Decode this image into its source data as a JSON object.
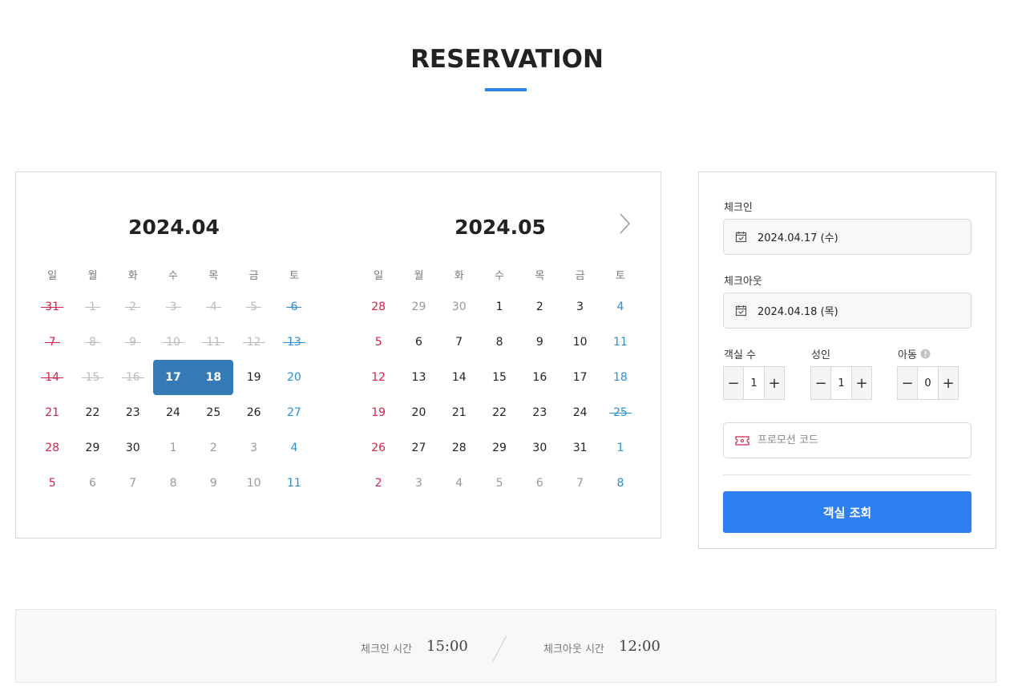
{
  "page": {
    "title": "RESERVATION"
  },
  "calendar": {
    "weekdays": [
      "일",
      "월",
      "화",
      "수",
      "목",
      "금",
      "토"
    ],
    "months": [
      {
        "title": "2024.04",
        "weeks": [
          [
            {
              "d": "31",
              "s": "dis"
            },
            {
              "d": "1",
              "s": "dis"
            },
            {
              "d": "2",
              "s": "dis"
            },
            {
              "d": "3",
              "s": "dis"
            },
            {
              "d": "4",
              "s": "dis"
            },
            {
              "d": "5",
              "s": "dis"
            },
            {
              "d": "6",
              "s": "dis"
            }
          ],
          [
            {
              "d": "7",
              "s": "dis"
            },
            {
              "d": "8",
              "s": "dis"
            },
            {
              "d": "9",
              "s": "dis"
            },
            {
              "d": "10",
              "s": "dis"
            },
            {
              "d": "11",
              "s": "dis"
            },
            {
              "d": "12",
              "s": "dis"
            },
            {
              "d": "13",
              "s": "dis"
            }
          ],
          [
            {
              "d": "14",
              "s": "dis"
            },
            {
              "d": "15",
              "s": "dis"
            },
            {
              "d": "16",
              "s": "dis"
            },
            {
              "d": "17",
              "s": "sel-start"
            },
            {
              "d": "18",
              "s": "sel-end"
            },
            {
              "d": "19",
              "s": ""
            },
            {
              "d": "20",
              "s": ""
            }
          ],
          [
            {
              "d": "21",
              "s": ""
            },
            {
              "d": "22",
              "s": ""
            },
            {
              "d": "23",
              "s": ""
            },
            {
              "d": "24",
              "s": ""
            },
            {
              "d": "25",
              "s": ""
            },
            {
              "d": "26",
              "s": ""
            },
            {
              "d": "27",
              "s": ""
            }
          ],
          [
            {
              "d": "28",
              "s": ""
            },
            {
              "d": "29",
              "s": ""
            },
            {
              "d": "30",
              "s": ""
            },
            {
              "d": "1",
              "s": "other"
            },
            {
              "d": "2",
              "s": "other"
            },
            {
              "d": "3",
              "s": "other"
            },
            {
              "d": "4",
              "s": "other"
            }
          ],
          [
            {
              "d": "5",
              "s": "other"
            },
            {
              "d": "6",
              "s": "other"
            },
            {
              "d": "7",
              "s": "other"
            },
            {
              "d": "8",
              "s": "other"
            },
            {
              "d": "9",
              "s": "other"
            },
            {
              "d": "10",
              "s": "other"
            },
            {
              "d": "11",
              "s": "other"
            }
          ]
        ]
      },
      {
        "title": "2024.05",
        "weeks": [
          [
            {
              "d": "28",
              "s": "other"
            },
            {
              "d": "29",
              "s": "other"
            },
            {
              "d": "30",
              "s": "other"
            },
            {
              "d": "1",
              "s": ""
            },
            {
              "d": "2",
              "s": ""
            },
            {
              "d": "3",
              "s": ""
            },
            {
              "d": "4",
              "s": ""
            }
          ],
          [
            {
              "d": "5",
              "s": ""
            },
            {
              "d": "6",
              "s": ""
            },
            {
              "d": "7",
              "s": ""
            },
            {
              "d": "8",
              "s": ""
            },
            {
              "d": "9",
              "s": ""
            },
            {
              "d": "10",
              "s": ""
            },
            {
              "d": "11",
              "s": ""
            }
          ],
          [
            {
              "d": "12",
              "s": ""
            },
            {
              "d": "13",
              "s": ""
            },
            {
              "d": "14",
              "s": ""
            },
            {
              "d": "15",
              "s": ""
            },
            {
              "d": "16",
              "s": ""
            },
            {
              "d": "17",
              "s": ""
            },
            {
              "d": "18",
              "s": ""
            }
          ],
          [
            {
              "d": "19",
              "s": ""
            },
            {
              "d": "20",
              "s": ""
            },
            {
              "d": "21",
              "s": ""
            },
            {
              "d": "22",
              "s": ""
            },
            {
              "d": "23",
              "s": ""
            },
            {
              "d": "24",
              "s": ""
            },
            {
              "d": "25",
              "s": "dis"
            }
          ],
          [
            {
              "d": "26",
              "s": ""
            },
            {
              "d": "27",
              "s": ""
            },
            {
              "d": "28",
              "s": ""
            },
            {
              "d": "29",
              "s": ""
            },
            {
              "d": "30",
              "s": ""
            },
            {
              "d": "31",
              "s": ""
            },
            {
              "d": "1",
              "s": "other"
            }
          ],
          [
            {
              "d": "2",
              "s": "other"
            },
            {
              "d": "3",
              "s": "other"
            },
            {
              "d": "4",
              "s": "other"
            },
            {
              "d": "5",
              "s": "other"
            },
            {
              "d": "6",
              "s": "other"
            },
            {
              "d": "7",
              "s": "other"
            },
            {
              "d": "8",
              "s": "other"
            }
          ]
        ]
      }
    ],
    "next_icon": "chevron-right-icon"
  },
  "booking": {
    "checkin_label": "체크인",
    "checkin_value": "2024.04.17 (수)",
    "checkout_label": "체크아웃",
    "checkout_value": "2024.04.18 (목)",
    "rooms_label": "객실 수",
    "rooms_value": "1",
    "adults_label": "성인",
    "adults_value": "1",
    "children_label": "아동",
    "children_value": "0",
    "minus": "−",
    "plus": "+",
    "promo_placeholder": "프로모션 코드",
    "search_label": "객실 조회"
  },
  "info": {
    "checkin_time_label": "체크인 시간",
    "checkin_time": "15:00",
    "checkout_time_label": "체크아웃 시간",
    "checkout_time": "12:00"
  },
  "colors": {
    "accent": "#2e7ff0",
    "selected": "#337ab7",
    "sunday": "#d6204b",
    "saturday": "#2a8fd5"
  }
}
